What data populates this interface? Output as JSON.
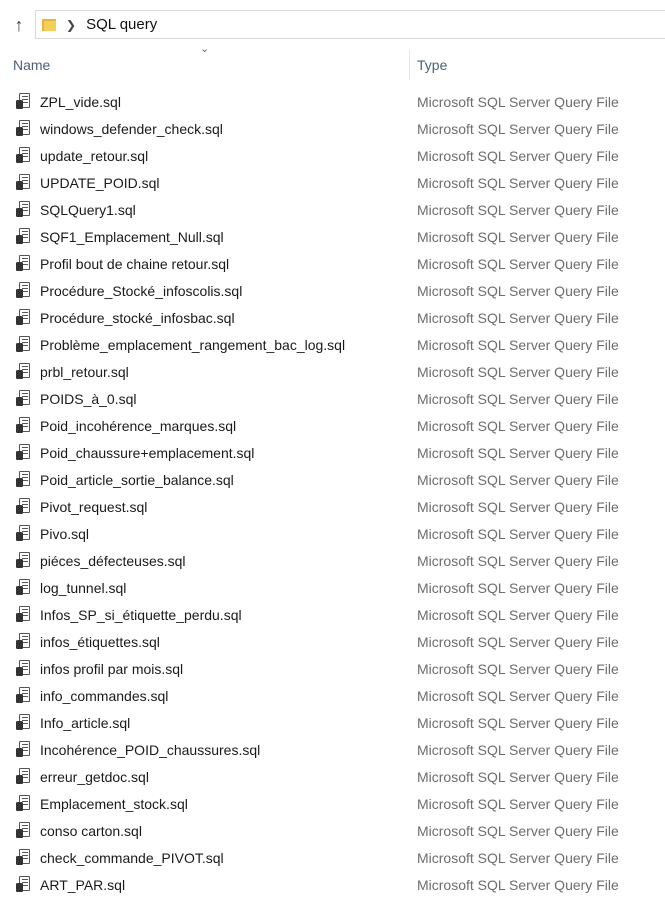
{
  "address_bar": {
    "breadcrumb": "SQL query"
  },
  "columns": {
    "name": "Name",
    "type": "Type"
  },
  "files": [
    {
      "name": "ZPL_vide.sql",
      "type": "Microsoft SQL Server Query File"
    },
    {
      "name": "windows_defender_check.sql",
      "type": "Microsoft SQL Server Query File"
    },
    {
      "name": "update_retour.sql",
      "type": "Microsoft SQL Server Query File"
    },
    {
      "name": "UPDATE_POID.sql",
      "type": "Microsoft SQL Server Query File"
    },
    {
      "name": "SQLQuery1.sql",
      "type": "Microsoft SQL Server Query File"
    },
    {
      "name": "SQF1_Emplacement_Null.sql",
      "type": "Microsoft SQL Server Query File"
    },
    {
      "name": "Profil bout de chaine retour.sql",
      "type": "Microsoft SQL Server Query File"
    },
    {
      "name": "Procédure_Stocké_infoscolis.sql",
      "type": "Microsoft SQL Server Query File"
    },
    {
      "name": "Procédure_stocké_infosbac.sql",
      "type": "Microsoft SQL Server Query File"
    },
    {
      "name": "Problème_emplacement_rangement_bac_log.sql",
      "type": "Microsoft SQL Server Query File"
    },
    {
      "name": "prbl_retour.sql",
      "type": "Microsoft SQL Server Query File"
    },
    {
      "name": "POIDS_à_0.sql",
      "type": "Microsoft SQL Server Query File"
    },
    {
      "name": "Poid_incohérence_marques.sql",
      "type": "Microsoft SQL Server Query File"
    },
    {
      "name": "Poid_chaussure+emplacement.sql",
      "type": "Microsoft SQL Server Query File"
    },
    {
      "name": "Poid_article_sortie_balance.sql",
      "type": "Microsoft SQL Server Query File"
    },
    {
      "name": "Pivot_request.sql",
      "type": "Microsoft SQL Server Query File"
    },
    {
      "name": "Pivo.sql",
      "type": "Microsoft SQL Server Query File"
    },
    {
      "name": "piéces_défecteuses.sql",
      "type": "Microsoft SQL Server Query File"
    },
    {
      "name": "log_tunnel.sql",
      "type": "Microsoft SQL Server Query File"
    },
    {
      "name": "Infos_SP_si_étiquette_perdu.sql",
      "type": "Microsoft SQL Server Query File"
    },
    {
      "name": "infos_étiquettes.sql",
      "type": "Microsoft SQL Server Query File"
    },
    {
      "name": "infos profil par mois.sql",
      "type": "Microsoft SQL Server Query File"
    },
    {
      "name": "info_commandes.sql",
      "type": "Microsoft SQL Server Query File"
    },
    {
      "name": "Info_article.sql",
      "type": "Microsoft SQL Server Query File"
    },
    {
      "name": "Incohérence_POID_chaussures.sql",
      "type": "Microsoft SQL Server Query File"
    },
    {
      "name": "erreur_getdoc.sql",
      "type": "Microsoft SQL Server Query File"
    },
    {
      "name": "Emplacement_stock.sql",
      "type": "Microsoft SQL Server Query File"
    },
    {
      "name": "conso carton.sql",
      "type": "Microsoft SQL Server Query File"
    },
    {
      "name": "check_commande_PIVOT.sql",
      "type": "Microsoft SQL Server Query File"
    },
    {
      "name": "ART_PAR.sql",
      "type": "Microsoft SQL Server Query File"
    }
  ]
}
